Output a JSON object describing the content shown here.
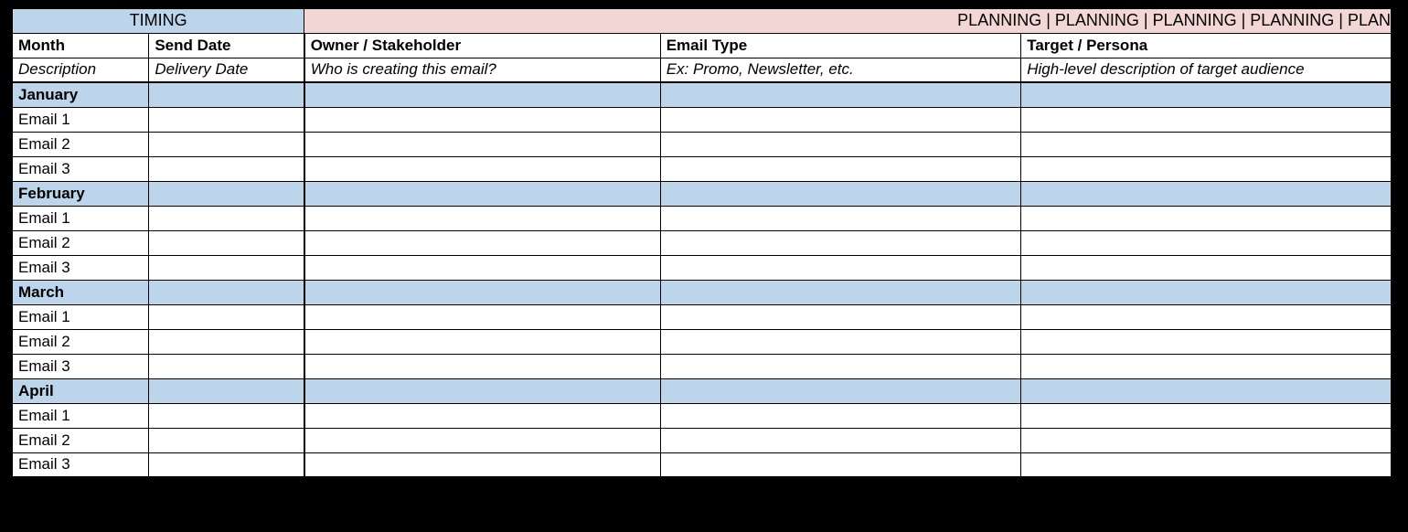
{
  "sections": {
    "timing_label": "TIMING",
    "planning_label": "PLANNING  |  PLANNING  |  PLANNING  |  PLANNING  |  PLAN"
  },
  "headers": {
    "month": "Month",
    "send_date": "Send Date",
    "owner": "Owner / Stakeholder",
    "email_type": "Email Type",
    "target": "Target / Persona"
  },
  "descriptions": {
    "month": "Description",
    "send_date": "Delivery Date",
    "owner": "Who is creating this email?",
    "email_type": "Ex: Promo, Newsletter, etc.",
    "target": "High-level description of target audience"
  },
  "months": [
    {
      "name": "January",
      "rows": [
        {
          "label": "Email 1",
          "send_date": "",
          "owner": "",
          "email_type": "",
          "target": ""
        },
        {
          "label": "Email 2",
          "send_date": "",
          "owner": "",
          "email_type": "",
          "target": ""
        },
        {
          "label": "Email 3",
          "send_date": "",
          "owner": "",
          "email_type": "",
          "target": ""
        }
      ]
    },
    {
      "name": "February",
      "rows": [
        {
          "label": "Email 1",
          "send_date": "",
          "owner": "",
          "email_type": "",
          "target": ""
        },
        {
          "label": "Email 2",
          "send_date": "",
          "owner": "",
          "email_type": "",
          "target": ""
        },
        {
          "label": "Email 3",
          "send_date": "",
          "owner": "",
          "email_type": "",
          "target": ""
        }
      ]
    },
    {
      "name": "March",
      "rows": [
        {
          "label": "Email 1",
          "send_date": "",
          "owner": "",
          "email_type": "",
          "target": ""
        },
        {
          "label": "Email 2",
          "send_date": "",
          "owner": "",
          "email_type": "",
          "target": ""
        },
        {
          "label": "Email 3",
          "send_date": "",
          "owner": "",
          "email_type": "",
          "target": ""
        }
      ]
    },
    {
      "name": "April",
      "rows": [
        {
          "label": "Email 1",
          "send_date": "",
          "owner": "",
          "email_type": "",
          "target": ""
        },
        {
          "label": "Email 2",
          "send_date": "",
          "owner": "",
          "email_type": "",
          "target": ""
        },
        {
          "label": "Email 3",
          "send_date": "",
          "owner": "",
          "email_type": "",
          "target": ""
        }
      ]
    }
  ]
}
